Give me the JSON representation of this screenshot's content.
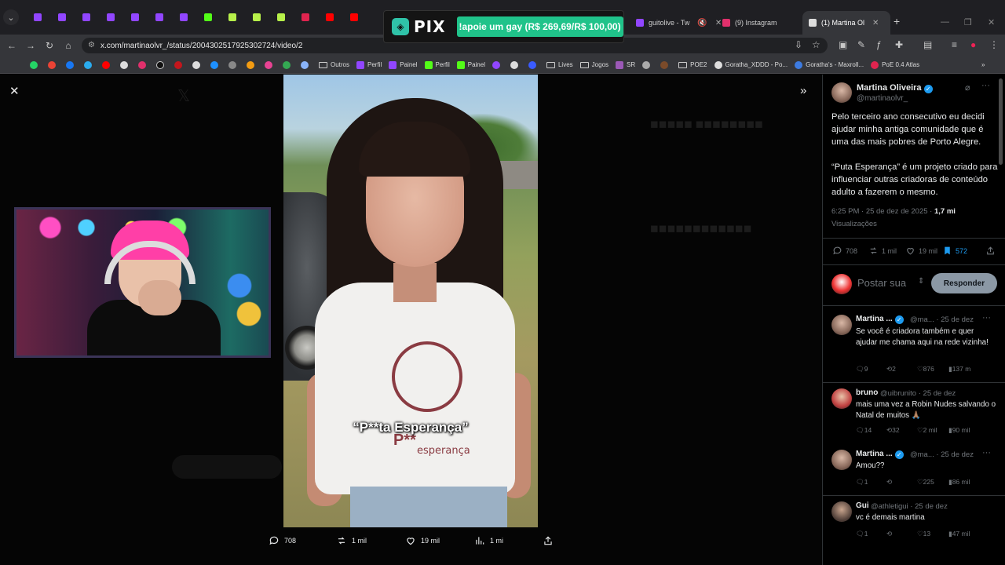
{
  "browser": {
    "tabs": [
      {
        "label": "guitolive - Tw",
        "color": "#9146ff"
      },
      {
        "label": "(9) Instagram",
        "color": "#e1306c"
      },
      {
        "label": "(1) Martina Ol",
        "color": "#ffffff"
      }
    ],
    "new_tab": "+",
    "url": "x.com/martinaolvr_/status/2004302517925302724/video/2",
    "bookmarks": [
      "Outros",
      "Perfil",
      "Painel",
      "Perfil",
      "Painel",
      "Lives",
      "Jogos",
      "SR",
      "POE2",
      "Goratha_XDDD - Po...",
      "Goratha's - Maxroll...",
      "PoE 0.4 Atlas"
    ]
  },
  "pix": {
    "logo": "PIX",
    "text": "!apoie um gay (R$ 269,69/R$ 100,00)",
    "color": "#20c38a"
  },
  "video": {
    "caption": "“P**ta Esperança”",
    "shirt_brand": "P**",
    "shirt_brand2": "esperança",
    "actions": {
      "replies": "708",
      "reposts": "1 mil",
      "likes": "19 mil",
      "views": "1 mi"
    }
  },
  "post": {
    "author": "Martina Oliveira",
    "handle": "@martinaolvr_",
    "text_p1": "Pelo terceiro ano consecutivo eu decidi ajudar minha antiga comunidade que é uma das mais pobres de Porto Alegre.",
    "text_p2": "“Puta Esperança” é um projeto criado para influenciar outras criadoras de conteúdo adulto a fazerem o mesmo.",
    "time": "6:25 PM · 25 de dez de 2025 · ",
    "views_count": "1,7 mi",
    "views_label": "Visualizações",
    "stats": {
      "replies": "708",
      "reposts": "1 mil",
      "likes": "19 mil",
      "bookmarks": "572"
    },
    "reply_placeholder": "Postar sua",
    "reply_button": "Responder"
  },
  "replies": [
    {
      "name": "Martina ...",
      "handle": "@ma...",
      "date": "· 25 de dez",
      "text": "Se você é criadora também e quer ajudar me chama aqui na rede vizinha!",
      "replies": "9",
      "reposts": "2",
      "likes": "876",
      "views": "137 m"
    },
    {
      "name": "bruno",
      "handle": "@uibrunito",
      "date": "· 25 de dez",
      "text": "mais uma vez a Robin Nudes salvando o Natal de muitos 🙏🏽",
      "replies": "14",
      "reposts": "32",
      "likes": "2 mil",
      "views": "90 mil"
    },
    {
      "name": "Martina ...",
      "handle": "@ma...",
      "date": "· 25 de dez",
      "text": "Amou??",
      "replies": "1",
      "reposts": "",
      "likes": "225",
      "views": "86 mil"
    },
    {
      "name": "Gui",
      "handle": "@athletigui",
      "date": "· 25 de dez",
      "text": "vc é demais martina",
      "replies": "1",
      "reposts": "",
      "likes": "13",
      "views": "47 mil"
    }
  ]
}
